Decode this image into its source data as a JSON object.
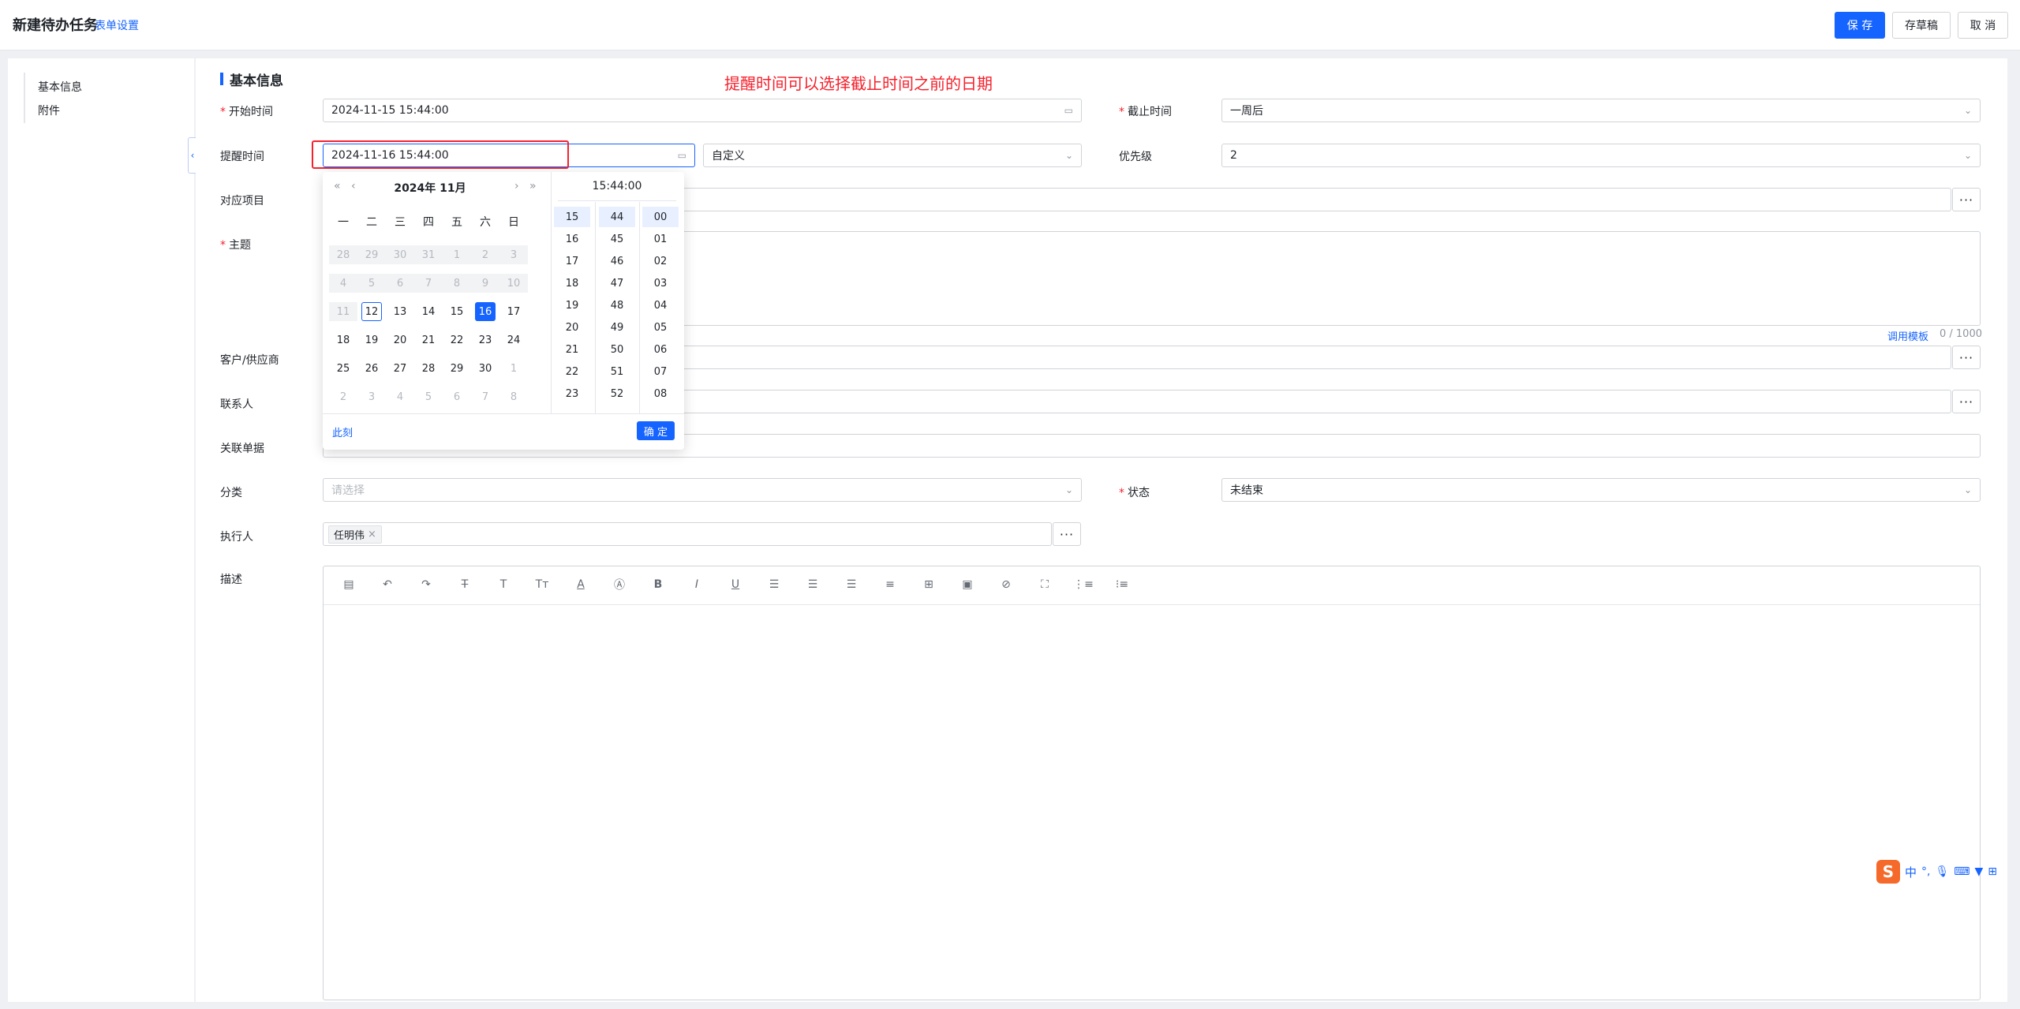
{
  "header": {
    "title": "新建待办任务",
    "form_settings": "表单设置",
    "save": "保 存",
    "draft": "存草稿",
    "cancel": "取 消"
  },
  "nav": {
    "items": [
      "基本信息",
      "附件"
    ]
  },
  "section": {
    "title": "基本信息"
  },
  "annotation": "提醒时间可以选择截止时间之前的日期",
  "form": {
    "start_time": {
      "label": "开始时间",
      "value": "2024-11-15 15:44:00"
    },
    "deadline": {
      "label": "截止时间",
      "value": "一周后"
    },
    "remind": {
      "label": "提醒时间",
      "value": "2024-11-16 15:44:00",
      "mode": "自定义"
    },
    "priority": {
      "label": "优先级",
      "value": "2"
    },
    "project": {
      "label": "对应项目"
    },
    "subject": {
      "label": "主题",
      "template_link": "调用模板",
      "counter": "0 / 1000"
    },
    "customer": {
      "label": "客户/供应商"
    },
    "contact": {
      "label": "联系人"
    },
    "related_doc": {
      "label": "关联单据"
    },
    "category": {
      "label": "分类",
      "placeholder": "请选择"
    },
    "status": {
      "label": "状态",
      "value": "未结束"
    },
    "executor": {
      "label": "执行人",
      "tag": "任明伟"
    },
    "description": {
      "label": "描述"
    }
  },
  "picker": {
    "year_month": "2024年  11月",
    "time_header": "15:44:00",
    "weekdays": [
      "一",
      "二",
      "三",
      "四",
      "五",
      "六",
      "日"
    ],
    "weeks": [
      [
        "28",
        "29",
        "30",
        "31",
        "1",
        "2",
        "3"
      ],
      [
        "4",
        "5",
        "6",
        "7",
        "8",
        "9",
        "10"
      ],
      [
        "11",
        "12",
        "13",
        "14",
        "15",
        "16",
        "17"
      ],
      [
        "18",
        "19",
        "20",
        "21",
        "22",
        "23",
        "24"
      ],
      [
        "25",
        "26",
        "27",
        "28",
        "29",
        "30",
        "1"
      ],
      [
        "2",
        "3",
        "4",
        "5",
        "6",
        "7",
        "8"
      ]
    ],
    "hours": [
      "15",
      "16",
      "17",
      "18",
      "19",
      "20",
      "21",
      "22",
      "23"
    ],
    "minutes": [
      "44",
      "45",
      "46",
      "47",
      "48",
      "49",
      "50",
      "51",
      "52"
    ],
    "seconds": [
      "00",
      "01",
      "02",
      "03",
      "04",
      "05",
      "06",
      "07",
      "08"
    ],
    "now": "此刻",
    "ok": "确 定",
    "today": "12",
    "selected": "16"
  },
  "toolbar_icons": [
    "format-icon",
    "undo-icon",
    "redo-icon",
    "strikethrough-icon",
    "text-icon",
    "font-size-icon",
    "font-color-icon",
    "background-color-icon",
    "bold-icon",
    "italic-icon",
    "underline-icon",
    "align-left-icon",
    "align-center-icon",
    "align-right-icon",
    "justify-icon",
    "table-icon",
    "image-icon",
    "attachment-icon",
    "fullscreen-icon",
    "ordered-list-icon",
    "unordered-list-icon"
  ],
  "colors": {
    "primary": "#1664ff",
    "required": "#f5222d"
  }
}
